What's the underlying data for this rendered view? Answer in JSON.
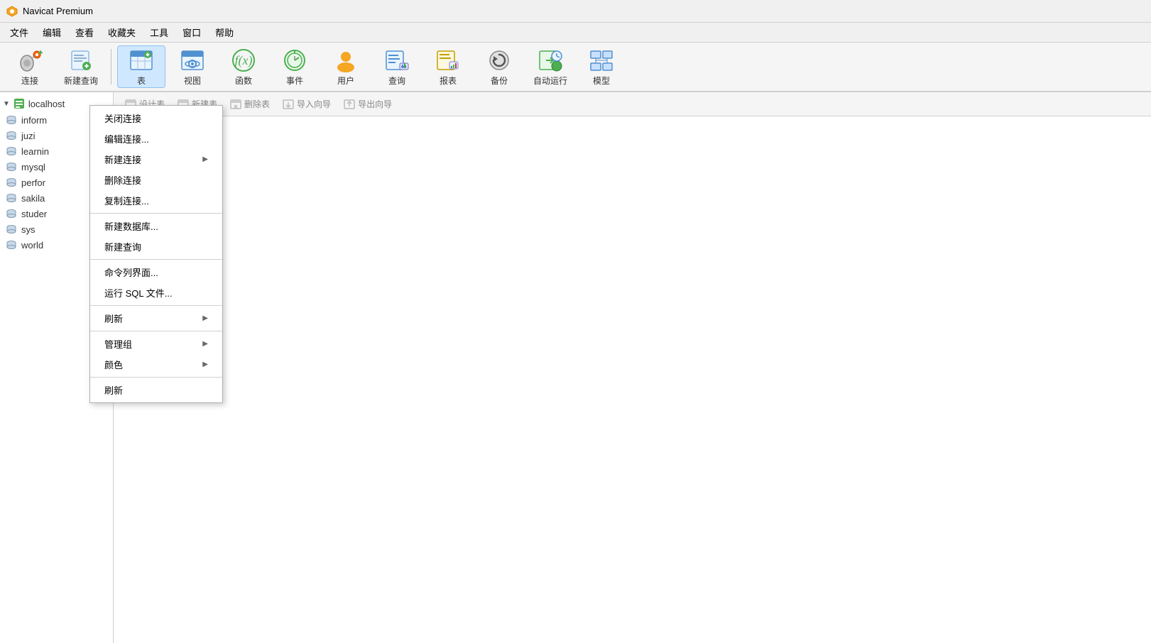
{
  "titleBar": {
    "icon": "navicat-icon",
    "title": "Navicat Premium"
  },
  "menuBar": {
    "items": [
      "文件",
      "编辑",
      "查看",
      "收藏夹",
      "工具",
      "窗口",
      "帮助"
    ]
  },
  "toolbar": {
    "buttons": [
      {
        "id": "connect",
        "label": "连接",
        "icon": "connect-icon"
      },
      {
        "id": "new-query",
        "label": "新建查询",
        "icon": "new-query-icon"
      },
      {
        "id": "table",
        "label": "表",
        "icon": "table-icon",
        "active": true
      },
      {
        "id": "view",
        "label": "视图",
        "icon": "view-icon"
      },
      {
        "id": "function",
        "label": "函数",
        "icon": "function-icon"
      },
      {
        "id": "event",
        "label": "事件",
        "icon": "event-icon"
      },
      {
        "id": "user",
        "label": "用户",
        "icon": "user-icon"
      },
      {
        "id": "query",
        "label": "查询",
        "icon": "query-icon"
      },
      {
        "id": "report",
        "label": "报表",
        "icon": "report-icon"
      },
      {
        "id": "backup",
        "label": "备份",
        "icon": "backup-icon"
      },
      {
        "id": "auto-run",
        "label": "自动运行",
        "icon": "auto-run-icon"
      },
      {
        "id": "model",
        "label": "模型",
        "icon": "model-icon"
      }
    ]
  },
  "secondaryToolbar": {
    "buttons": [
      {
        "label": "设计表",
        "icon": "design-table-icon",
        "enabled": false
      },
      {
        "label": "新建表",
        "icon": "new-table-icon",
        "enabled": false
      },
      {
        "label": "删除表",
        "icon": "delete-table-icon",
        "enabled": false
      },
      {
        "label": "导入向导",
        "icon": "import-icon",
        "enabled": false
      },
      {
        "label": "导出向导",
        "icon": "export-icon",
        "enabled": false
      }
    ]
  },
  "sidebar": {
    "connection": {
      "label": "localhost",
      "expanded": true
    },
    "databases": [
      {
        "name": "inform"
      },
      {
        "name": "juzi"
      },
      {
        "name": "learnin"
      },
      {
        "name": "mysql"
      },
      {
        "name": "perfor"
      },
      {
        "name": "sakila"
      },
      {
        "name": "studer"
      },
      {
        "name": "sys"
      },
      {
        "name": "world"
      }
    ]
  },
  "contextMenu": {
    "items": [
      {
        "label": "关闭连接",
        "hasArrow": false,
        "isSeparator": false
      },
      {
        "label": "编辑连接...",
        "hasArrow": false,
        "isSeparator": false
      },
      {
        "label": "新建连接",
        "hasArrow": true,
        "isSeparator": false
      },
      {
        "label": "删除连接",
        "hasArrow": false,
        "isSeparator": false
      },
      {
        "label": "复制连接...",
        "hasArrow": false,
        "isSeparator": false
      },
      {
        "label": "",
        "hasArrow": false,
        "isSeparator": true
      },
      {
        "label": "新建数据库...",
        "hasArrow": false,
        "isSeparator": false
      },
      {
        "label": "新建查询",
        "hasArrow": false,
        "isSeparator": false
      },
      {
        "label": "",
        "hasArrow": false,
        "isSeparator": true
      },
      {
        "label": "命令列界面...",
        "hasArrow": false,
        "isSeparator": false
      },
      {
        "label": "运行 SQL 文件...",
        "hasArrow": false,
        "isSeparator": false
      },
      {
        "label": "",
        "hasArrow": false,
        "isSeparator": true
      },
      {
        "label": "刷新",
        "hasArrow": true,
        "isSeparator": false
      },
      {
        "label": "",
        "hasArrow": false,
        "isSeparator": true
      },
      {
        "label": "管理组",
        "hasArrow": true,
        "isSeparator": false
      },
      {
        "label": "颜色",
        "hasArrow": true,
        "isSeparator": false
      },
      {
        "label": "",
        "hasArrow": false,
        "isSeparator": true
      },
      {
        "label": "刷新",
        "hasArrow": false,
        "isSeparator": false
      }
    ]
  }
}
